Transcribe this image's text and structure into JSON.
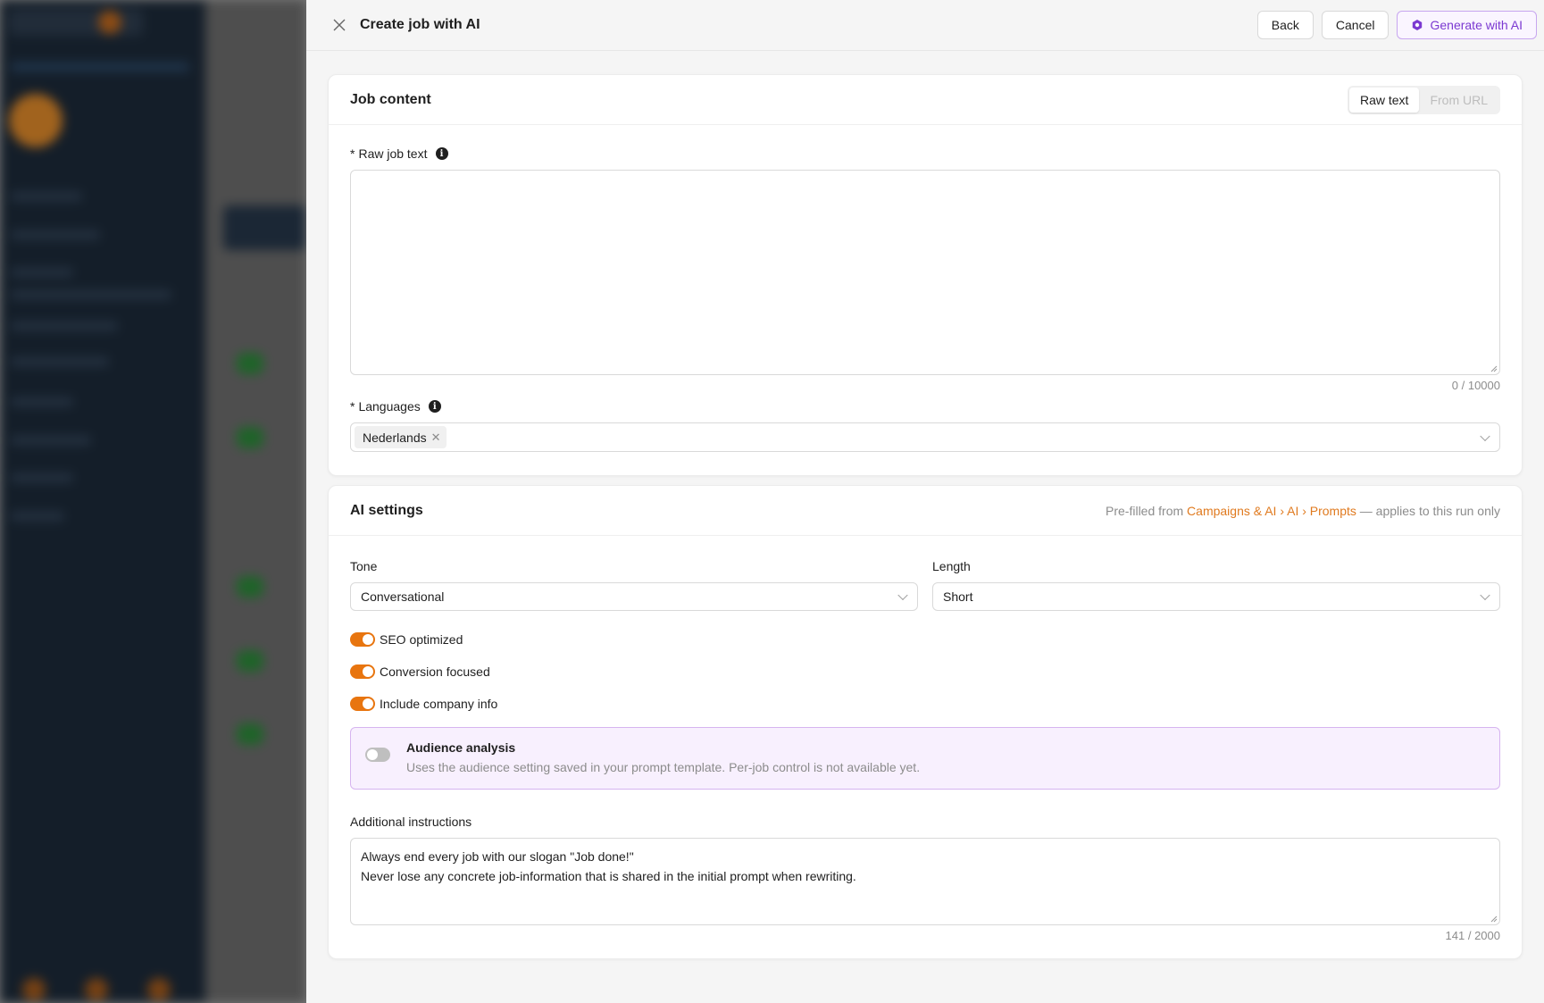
{
  "drawer": {
    "title": "Create job with AI",
    "back_label": "Back",
    "cancel_label": "Cancel",
    "generate_label": "Generate with AI"
  },
  "job_content": {
    "title": "Job content",
    "tabs": [
      {
        "label": "Raw text",
        "active": true
      },
      {
        "label": "From URL",
        "active": false
      }
    ],
    "raw_text_label": "Raw job text",
    "raw_text_value": "",
    "raw_text_counter": "0 / 10000",
    "languages_label": "Languages",
    "languages_selected": [
      "Nederlands"
    ]
  },
  "ai_settings": {
    "title": "AI settings",
    "note_prefix": "Pre-filled from ",
    "note_link": "Campaigns & AI › AI › Prompts",
    "note_suffix": " — applies to this run only",
    "tone_label": "Tone",
    "tone_value": "Conversational",
    "length_label": "Length",
    "length_value": "Short",
    "toggles": [
      {
        "label": "SEO optimized",
        "on": true
      },
      {
        "label": "Conversion focused",
        "on": true
      },
      {
        "label": "Include company info",
        "on": true
      }
    ],
    "audience": {
      "title": "Audience analysis",
      "description": "Uses the audience setting saved in your prompt template. Per-job control is not available yet.",
      "on": false
    },
    "instructions_label": "Additional instructions",
    "instructions_line1": "Always end every job with our slogan \"Job done!\"",
    "instructions_line2": "Never lose any concrete job-information that is shared in the initial prompt when rewriting.",
    "instructions_counter": "141 / 2000"
  },
  "colors": {
    "accent": "#e8750f",
    "ai_purple": "#7b39d1",
    "audience_bg": "#f8f0fe"
  }
}
